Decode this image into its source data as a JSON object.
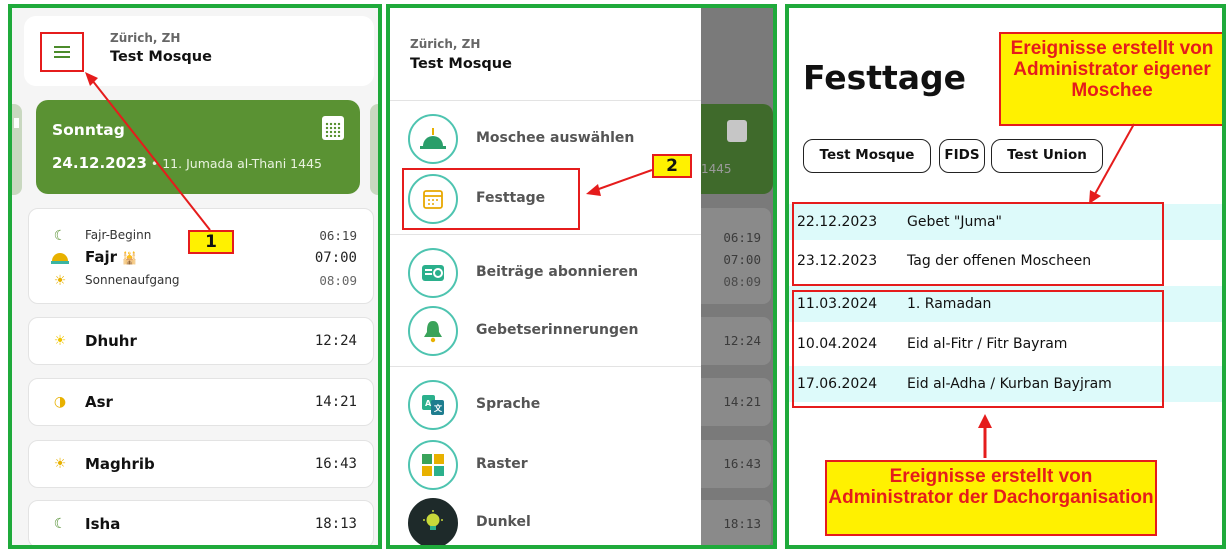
{
  "app": {
    "location": "Zürich, ZH",
    "mosque": "Test Mosque"
  },
  "home": {
    "day_name": "Sonntag",
    "date": "24.12.2023",
    "hijri": " • 11. Jumada al-Thani 1445",
    "fajr_group": [
      {
        "label": "Fajr-Beginn",
        "time": "06:19",
        "icon": "crescent-moon-icon"
      },
      {
        "label": "Fajr",
        "time": "07:00",
        "icon": "sunrise-dome-icon"
      },
      {
        "label": "Sonnenaufgang",
        "time": "08:09",
        "icon": "horizon-sun-icon"
      }
    ],
    "fajr_mosque_icon": "🕌",
    "prayers": [
      {
        "label": "Dhuhr",
        "time": "12:24",
        "icon": "sun-icon"
      },
      {
        "label": "Asr",
        "time": "14:21",
        "icon": "sun-half-icon"
      },
      {
        "label": "Maghrib",
        "time": "16:43",
        "icon": "sunset-icon"
      },
      {
        "label": "Isha",
        "time": "18:13",
        "icon": "moon-star-icon"
      }
    ],
    "callout": "1"
  },
  "drawer": {
    "items": [
      {
        "label": "Moschee auswählen",
        "icon": "mosque-dome-icon"
      },
      {
        "label": "Festtage",
        "icon": "calendar-icon"
      },
      {
        "label": "Beiträge abonnieren",
        "icon": "newsletter-icon"
      },
      {
        "label": "Gebetserinnerungen",
        "icon": "bell-icon"
      },
      {
        "label": "Sprache",
        "icon": "language-icon"
      },
      {
        "label": "Raster",
        "icon": "grid-icon"
      },
      {
        "label": "Dunkel",
        "icon": "lightbulb-icon"
      }
    ],
    "overlay_hijri": "1445",
    "overlay_times": [
      "06:19",
      "07:00",
      "08:09",
      "12:24",
      "14:21",
      "16:43",
      "18:13"
    ],
    "callout": "2"
  },
  "festtage": {
    "title": "Festtage",
    "chips": [
      "Test Mosque",
      "FIDS",
      "Test Union"
    ],
    "events": [
      {
        "date": "22.12.2023",
        "name": "Gebet \"Juma\""
      },
      {
        "date": "23.12.2023",
        "name": "Tag der offenen Moscheen"
      },
      {
        "date": "11.03.2024",
        "name": "1. Ramadan"
      },
      {
        "date": "10.04.2024",
        "name": "Eid al-Fitr / Fitr Bayram"
      },
      {
        "date": "17.06.2024",
        "name": "Eid al-Adha / Kurban Bayjram"
      }
    ],
    "note_top": "Ereignisse erstellt von Administrator eigener Moschee",
    "note_bottom": "Ereignisse erstellt von Administrator der Dachorganisation"
  },
  "colors": {
    "frame_green": "#1faa3b",
    "card_green": "#5a9233",
    "teal": "#4ec4b0",
    "annotation_red": "#e51c1c",
    "annotation_yellow": "#fff100"
  }
}
